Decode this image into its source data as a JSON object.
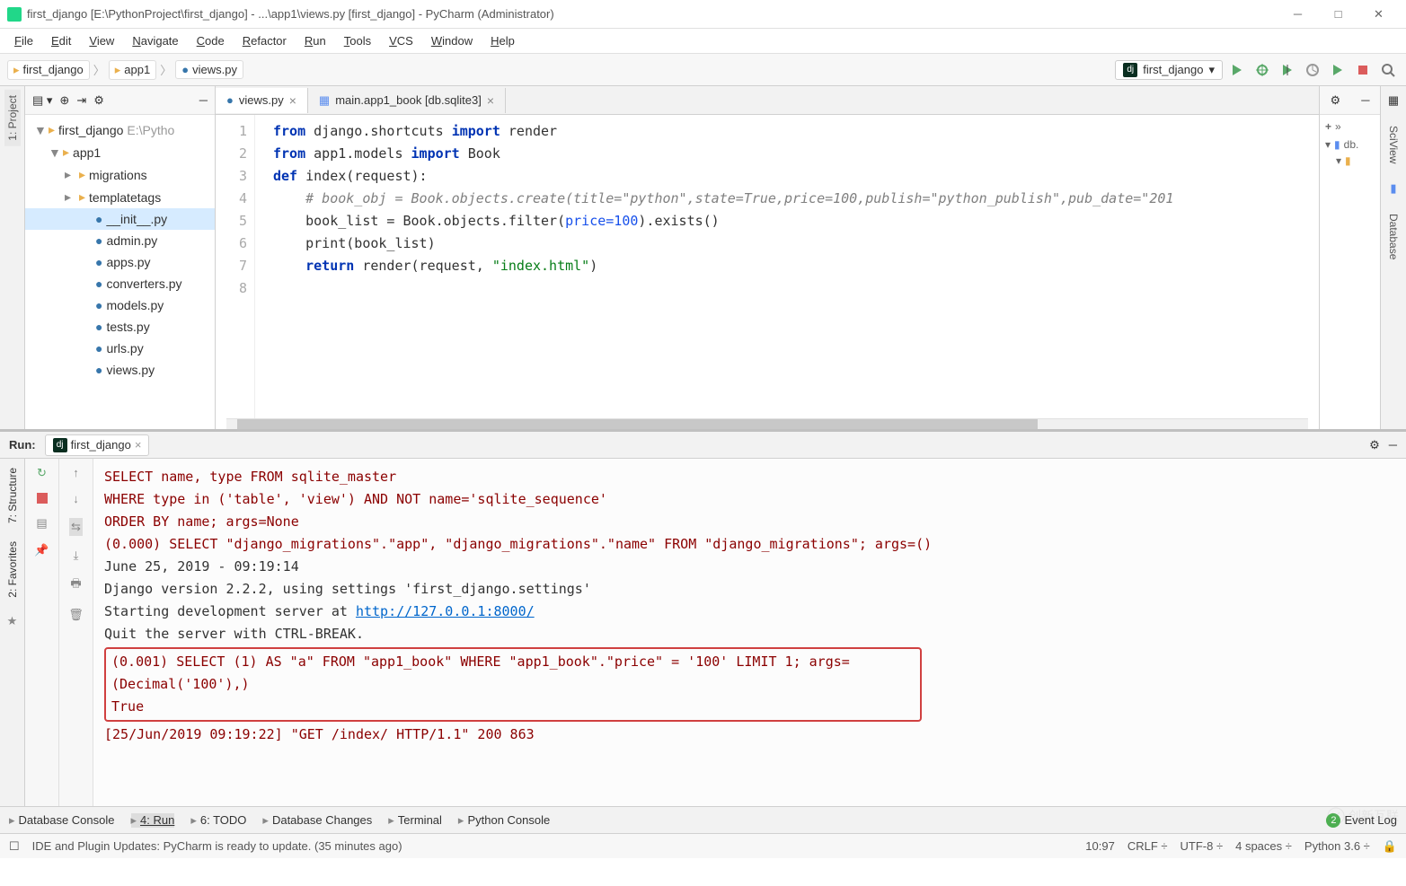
{
  "title": "first_django [E:\\PythonProject\\first_django] - ...\\app1\\views.py [first_django] - PyCharm (Administrator)",
  "menu": [
    "File",
    "Edit",
    "View",
    "Navigate",
    "Code",
    "Refactor",
    "Run",
    "Tools",
    "VCS",
    "Window",
    "Help"
  ],
  "menu_ul": [
    "F",
    "E",
    "V",
    "N",
    "C",
    "R",
    "R",
    "T",
    "V",
    "W",
    "H"
  ],
  "crumbs": [
    {
      "icon": "folder",
      "label": "first_django"
    },
    {
      "icon": "folder",
      "label": "app1"
    },
    {
      "icon": "python",
      "label": "views.py"
    }
  ],
  "run_config": "first_django",
  "project": {
    "root": {
      "label": "first_django",
      "path": "E:\\Pytho"
    },
    "tree": [
      {
        "indent": 0,
        "icon": "folder-open",
        "label": "first_django",
        "expand": "▼",
        "extra": "E:\\Pytho"
      },
      {
        "indent": 1,
        "icon": "folder-open",
        "label": "app1",
        "expand": "▼"
      },
      {
        "indent": 2,
        "icon": "folder",
        "label": "migrations",
        "expand": "▸"
      },
      {
        "indent": 2,
        "icon": "folder",
        "label": "templatetags",
        "expand": "▸"
      },
      {
        "indent": 3,
        "icon": "python",
        "label": "__init__.py",
        "sel": true
      },
      {
        "indent": 3,
        "icon": "python",
        "label": "admin.py"
      },
      {
        "indent": 3,
        "icon": "python",
        "label": "apps.py"
      },
      {
        "indent": 3,
        "icon": "python",
        "label": "converters.py"
      },
      {
        "indent": 3,
        "icon": "python",
        "label": "models.py"
      },
      {
        "indent": 3,
        "icon": "python",
        "label": "tests.py"
      },
      {
        "indent": 3,
        "icon": "python",
        "label": "urls.py"
      },
      {
        "indent": 3,
        "icon": "python",
        "label": "views.py"
      }
    ]
  },
  "editor": {
    "tabs": [
      {
        "icon": "python",
        "label": "views.py",
        "active": true
      },
      {
        "icon": "table",
        "label": "main.app1_book [db.sqlite3]"
      }
    ],
    "lines": [
      1,
      2,
      3,
      4,
      5,
      6,
      7,
      8
    ],
    "code_html": "<span class='kw'>from</span> django.shortcuts <span class='kw'>import</span> render\n<span class='kw'>from</span> app1.models <span class='kw'>import</span> Book\n<span class='kw'>def</span> index(request):\n    <span class='cm'># book_obj = Book.objects.create(title=\"python\",state=True,price=100,publish=\"python_publish\",pub_date=\"201</span>\n    book_list = Book.objects.filter(<span class='num'>price=100</span>).exists()\n    print(book_list)\n    <span class='kw'>return</span> render(request, <span class='st'>\"index.html\"</span>)\n"
  },
  "sciview": {
    "row1": "db.",
    "row2": ""
  },
  "right_rail": [
    "SciView",
    "Database"
  ],
  "run": {
    "label": "Run:",
    "tab": "first_django",
    "lines": [
      {
        "cls": "sql",
        "text": "           SELECT name, type FROM sqlite_master"
      },
      {
        "cls": "sql",
        "text": "           WHERE type in ('table', 'view') AND NOT name='sqlite_sequence'"
      },
      {
        "cls": "sql",
        "text": "           ORDER BY name; args=None"
      },
      {
        "cls": "sql",
        "text": "(0.000) SELECT \"django_migrations\".\"app\", \"django_migrations\".\"name\" FROM \"django_migrations\"; args=()"
      },
      {
        "cls": "",
        "text": "June 25, 2019 - 09:19:14"
      },
      {
        "cls": "",
        "text": "Django version 2.2.2, using settings 'first_django.settings'"
      },
      {
        "cls": "link-line",
        "text": "Starting development server at ",
        "link": "http://127.0.0.1:8000/"
      },
      {
        "cls": "",
        "text": "Quit the server with CTRL-BREAK."
      },
      {
        "cls": "hl",
        "text": "(0.001) SELECT (1) AS \"a\" FROM \"app1_book\" WHERE \"app1_book\".\"price\" = '100'  LIMIT 1; args=(Decimal('100'),)\nTrue"
      },
      {
        "cls": "sql",
        "text": "[25/Jun/2019 09:19:22] \"GET /index/ HTTP/1.1\" 200 863"
      }
    ]
  },
  "bottom": [
    {
      "icon": "db",
      "label": "Database Console"
    },
    {
      "icon": "run",
      "label": "4: Run",
      "active": true
    },
    {
      "icon": "todo",
      "label": "6: TODO"
    },
    {
      "icon": "db",
      "label": "Database Changes"
    },
    {
      "icon": "term",
      "label": "Terminal"
    },
    {
      "icon": "py",
      "label": "Python Console"
    }
  ],
  "event_log": {
    "count": "2",
    "label": "Event Log"
  },
  "status": {
    "msg": "IDE and Plugin Updates: PyCharm is ready to update. (35 minutes ago)",
    "pos": "10:97",
    "eol": "CRLF",
    "enc": "UTF-8",
    "indent": "4 spaces",
    "py": "Python 3.6"
  },
  "left_bottom_rail": [
    "7: Structure",
    "2: Favorites"
  ],
  "watermark": "创新互联"
}
